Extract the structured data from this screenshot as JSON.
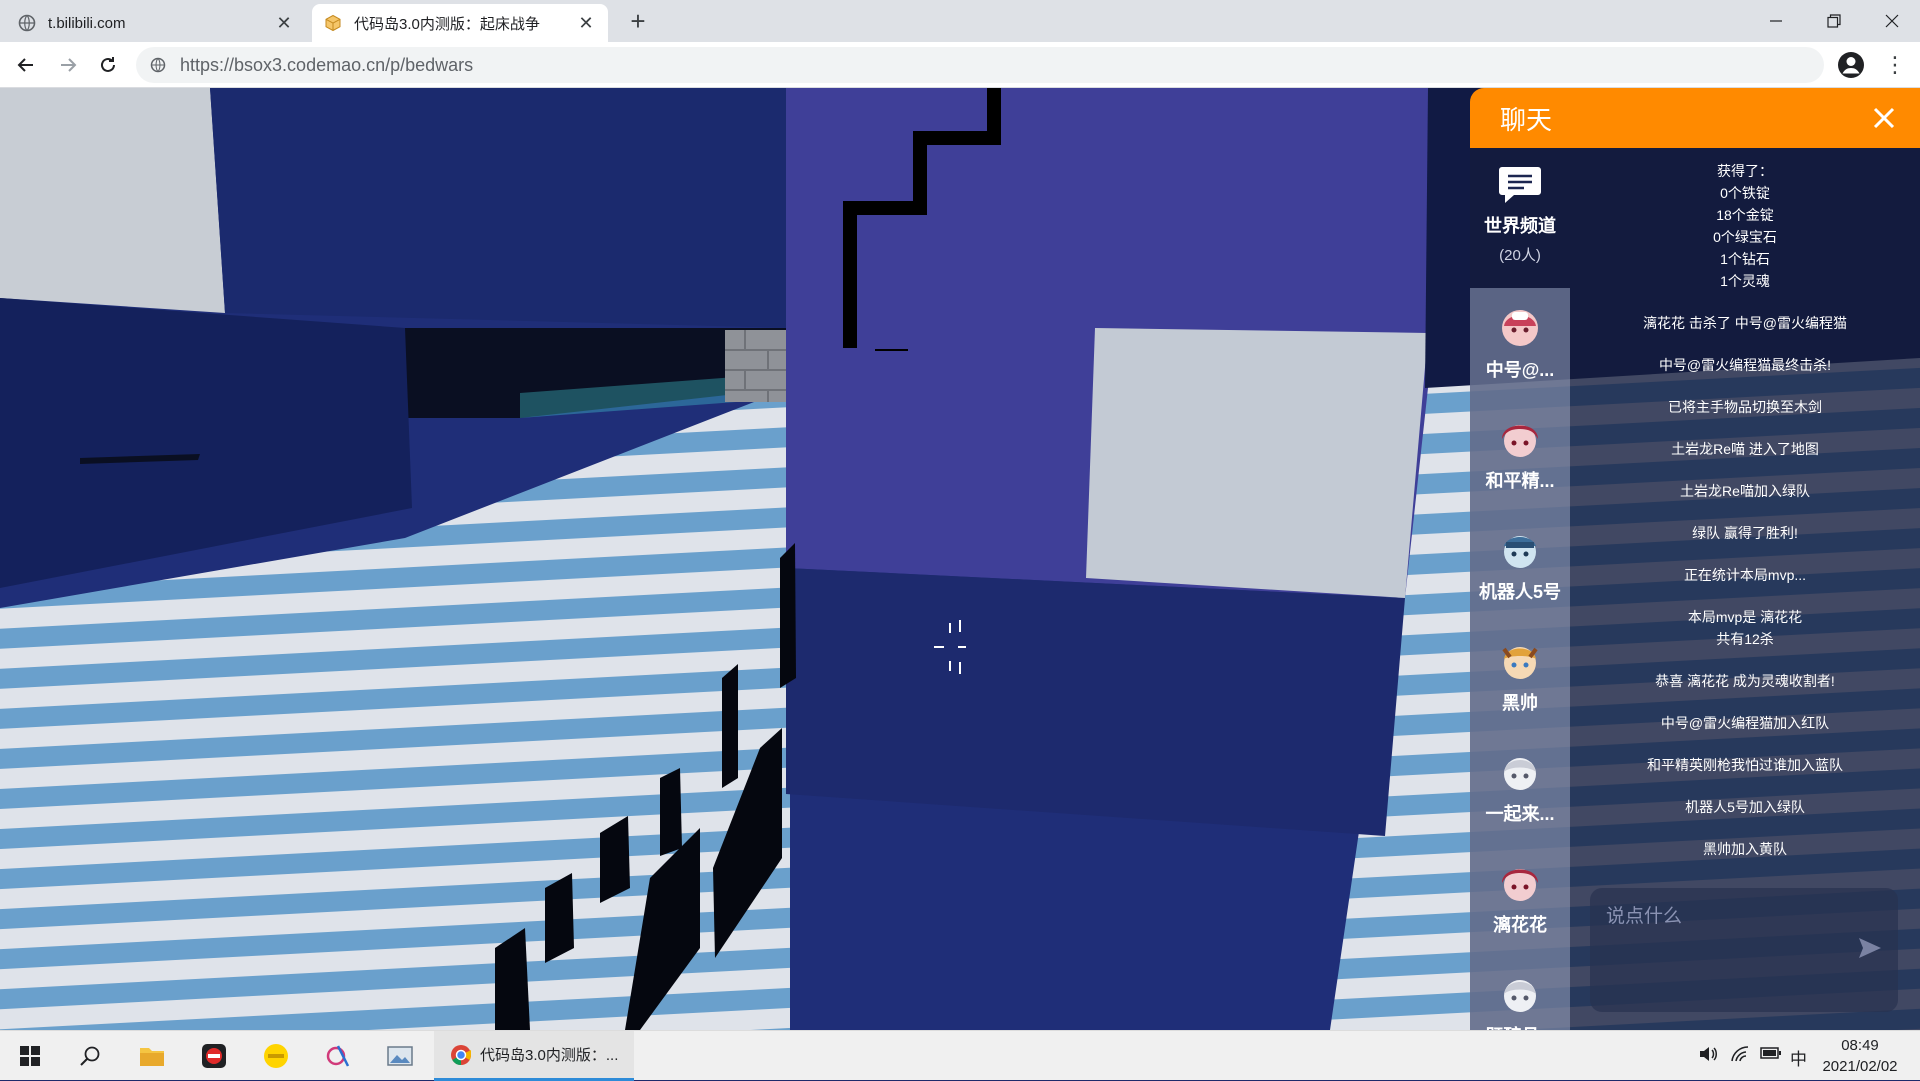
{
  "browser": {
    "tabs": [
      {
        "title": "t.bilibili.com",
        "active": false
      },
      {
        "title": "代码岛3.0内测版：起床战争",
        "active": true
      }
    ],
    "new_tab_label": "+",
    "url": "https://bsox3.codemao.cn/p/bedwars"
  },
  "chat": {
    "title": "聊天",
    "channel": {
      "name": "世界频道",
      "count": "(20人)"
    },
    "players": [
      {
        "name": "中号@..."
      },
      {
        "name": "和平精..."
      },
      {
        "name": "机器人5号"
      },
      {
        "name": "黑帅"
      },
      {
        "name": "一起来..."
      },
      {
        "name": "漓花花"
      },
      {
        "name": "既醉且..."
      }
    ],
    "messages": [
      "获得了：\n0个铁锭\n18个金锭\n0个绿宝石\n1个钻石\n1个灵魂",
      "漓花花 击杀了 中号@雷火编程猫",
      "中号@雷火编程猫最终击杀!",
      "已将主手物品切换至木剑",
      "土岩龙Re喵 进入了地图",
      "土岩龙Re喵加入绿队",
      "绿队 赢得了胜利!",
      "正在统计本局mvp...",
      "本局mvp是 漓花花\n共有12杀",
      "恭喜 漓花花 成为灵魂收割者!",
      "中号@雷火编程猫加入红队",
      "和平精英刚枪我怕过谁加入蓝队",
      "机器人5号加入绿队",
      "黑帅加入黄队"
    ],
    "input_placeholder": "说点什么"
  },
  "taskbar": {
    "active_app": "代码岛3.0内测版：...",
    "ime": "中",
    "time": "08:49",
    "date": "2021/02/02"
  },
  "colors": {
    "chat_header": "#ff8a00",
    "taskbar_accent": "#2e8bd8"
  }
}
